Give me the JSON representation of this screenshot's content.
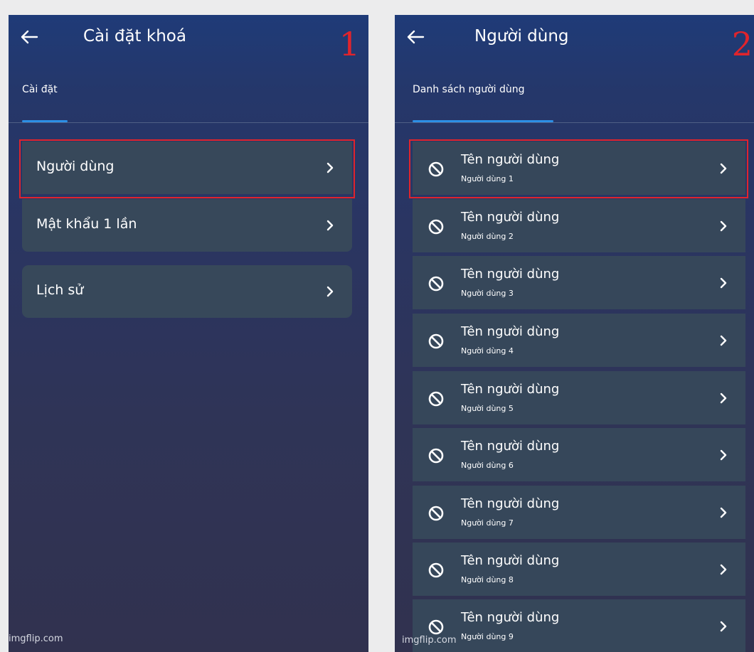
{
  "screen1": {
    "title": "Cài đặt khoá",
    "step": "1",
    "tab": "Cài đặt",
    "items": [
      {
        "label": "Người dùng"
      },
      {
        "label": "Mật khẩu 1 lần"
      },
      {
        "label": "Lịch sử"
      }
    ],
    "watermark": "imgflip.com"
  },
  "screen2": {
    "title": "Người dùng",
    "step": "2",
    "tab": "Danh sách người dùng",
    "users": [
      {
        "name": "Tên người dùng",
        "sub": "Người dùng 1"
      },
      {
        "name": "Tên người dùng",
        "sub": "Người dùng 2"
      },
      {
        "name": "Tên người dùng",
        "sub": "Người dùng 3"
      },
      {
        "name": "Tên người dùng",
        "sub": "Người dùng 4"
      },
      {
        "name": "Tên người dùng",
        "sub": "Người dùng 5"
      },
      {
        "name": "Tên người dùng",
        "sub": "Người dùng 6"
      },
      {
        "name": "Tên người dùng",
        "sub": "Người dùng 7"
      },
      {
        "name": "Tên người dùng",
        "sub": "Người dùng 8"
      },
      {
        "name": "Tên người dùng",
        "sub": "Người dùng 9"
      }
    ],
    "watermark": "imgflip.com"
  },
  "icons": {
    "back": "arrow-left-icon",
    "chevron": "chevron-right-icon",
    "user_status": "ban-icon"
  },
  "colors": {
    "highlight": "#e0242c",
    "tab_indicator": "#2c8fe6",
    "item_background": "#37485a"
  }
}
